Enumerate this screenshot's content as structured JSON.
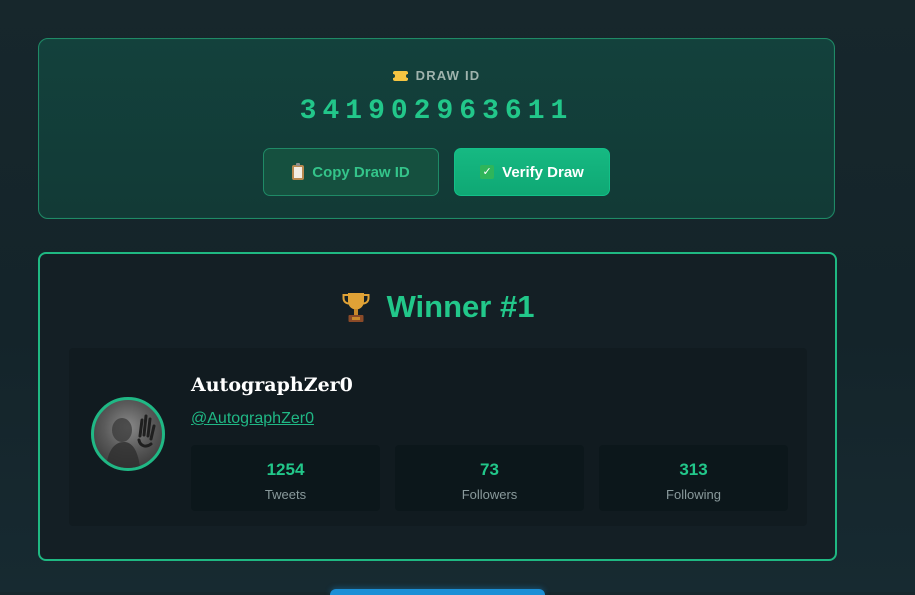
{
  "draw": {
    "label": "DRAW ID",
    "label_icon": "ticket-icon",
    "id": "341902963611",
    "copy_button": {
      "label": "Copy Draw ID",
      "icon": "clipboard-icon"
    },
    "verify_button": {
      "label": "Verify Draw",
      "icon": "check-icon"
    }
  },
  "winner": {
    "title": "Winner #1",
    "title_icon": "trophy-icon",
    "display_name": "AutographZer0",
    "handle": "@AutographZer0",
    "stats": [
      {
        "value": "1254",
        "label": "Tweets"
      },
      {
        "value": "73",
        "label": "Followers"
      },
      {
        "value": "313",
        "label": "Following"
      }
    ]
  },
  "colors": {
    "accent": "#22c78a",
    "card_border": "#1fb882",
    "background": "#14242a"
  }
}
